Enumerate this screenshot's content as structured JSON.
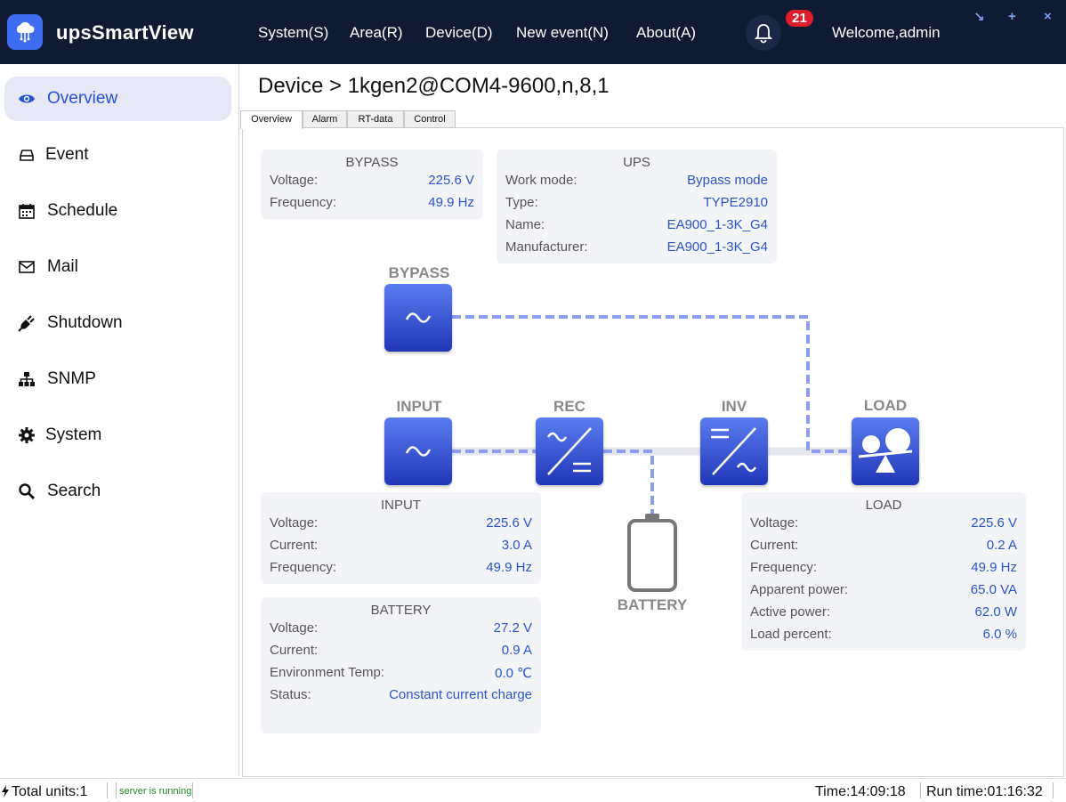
{
  "app": {
    "title": "upsSmartView"
  },
  "menu": [
    "System(S)",
    "Area(R)",
    "Device(D)",
    "New event(N)",
    "About(A)"
  ],
  "notifications": {
    "count": "21"
  },
  "welcome": "Welcome,admin",
  "window_controls": {
    "minimize": "↘",
    "maximize": "+",
    "close": "×"
  },
  "sidebar": {
    "items": [
      {
        "label": "Overview",
        "icon": "eye-icon",
        "active": true
      },
      {
        "label": "Event",
        "icon": "inbox-icon"
      },
      {
        "label": "Schedule",
        "icon": "calendar-icon"
      },
      {
        "label": "Mail",
        "icon": "mail-icon"
      },
      {
        "label": "Shutdown",
        "icon": "plug-icon"
      },
      {
        "label": "SNMP",
        "icon": "network-icon"
      },
      {
        "label": "System",
        "icon": "gear-icon"
      },
      {
        "label": "Search",
        "icon": "search-icon"
      }
    ]
  },
  "breadcrumb": "Device > 1kgen2@COM4-9600,n,8,1",
  "tabs": [
    "Overview",
    "Alarm",
    "RT-data",
    "Control"
  ],
  "cards": {
    "bypass": {
      "title": "BYPASS",
      "rows": [
        {
          "k": "Voltage:",
          "v": "225.6  V"
        },
        {
          "k": "Frequency:",
          "v": "49.9 Hz"
        }
      ]
    },
    "ups": {
      "title": "UPS",
      "rows": [
        {
          "k": "Work mode:",
          "v": "Bypass mode"
        },
        {
          "k": "Type:",
          "v": "TYPE2910"
        },
        {
          "k": "Name:",
          "v": "EA900_1-3K_G4"
        },
        {
          "k": "Manufacturer:",
          "v": "EA900_1-3K_G4"
        }
      ]
    },
    "input": {
      "title": "INPUT",
      "rows": [
        {
          "k": "Voltage:",
          "v": "225.6 V"
        },
        {
          "k": "Current:",
          "v": "3.0 A"
        },
        {
          "k": "Frequency:",
          "v": "49.9 Hz"
        }
      ]
    },
    "battery": {
      "title": "BATTERY",
      "rows": [
        {
          "k": "Voltage:",
          "v": "27.2 V"
        },
        {
          "k": "Current:",
          "v": "0.9 A"
        },
        {
          "k": "Environment Temp:",
          "v": "0.0 ℃"
        },
        {
          "k": "Status:",
          "v": "Constant current charge"
        }
      ]
    },
    "load": {
      "title": "LOAD",
      "rows": [
        {
          "k": "Voltage:",
          "v": "225.6 V"
        },
        {
          "k": "Current:",
          "v": "0.2 A"
        },
        {
          "k": "Frequency:",
          "v": "49.9 Hz"
        },
        {
          "k": "Apparent power:",
          "v": "65.0 VA"
        },
        {
          "k": "Active power:",
          "v": "62.0 W"
        },
        {
          "k": "Load percent:",
          "v": "6.0 %"
        }
      ]
    }
  },
  "diagram": {
    "bypass": "BYPASS",
    "input": "INPUT",
    "rec": "REC",
    "inv": "INV",
    "load": "LOAD",
    "battery": "BATTERY"
  },
  "status": {
    "total_units": "Total units:1",
    "server": "server is running",
    "time": "Time:14:09:18",
    "run_time": "Run time:01:16:32"
  },
  "colors": {
    "topbar": "#101a33",
    "accent": "#3f6cf0",
    "value": "#2a55c8",
    "badge": "#e01e2c"
  }
}
